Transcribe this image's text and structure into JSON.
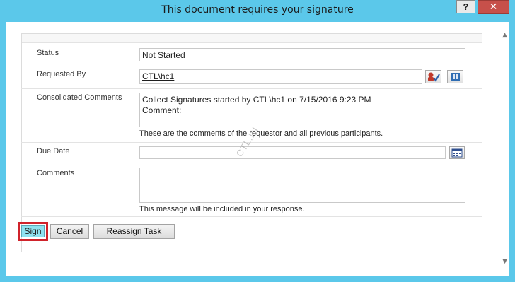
{
  "window": {
    "title": "This document requires your signature",
    "help_label": "?",
    "close_label": "✕"
  },
  "form": {
    "status": {
      "label": "Status",
      "value": "Not Started"
    },
    "requested_by": {
      "label": "Requested By",
      "value": "CTL\\hc1"
    },
    "consolidated_comments": {
      "label": "Consolidated Comments",
      "line1": "Collect Signatures started by CTL\\hc1 on 7/15/2016 9:23 PM",
      "line2": "Comment:",
      "hint": "These are the comments of the requestor and all previous participants."
    },
    "due_date": {
      "label": "Due Date",
      "value": ""
    },
    "comments": {
      "label": "Comments",
      "value": "",
      "hint": "This message will be included in your response."
    }
  },
  "buttons": {
    "sign": "Sign",
    "cancel": "Cancel",
    "reassign": "Reassign Task"
  },
  "watermark": "CTL.IN",
  "icons": {
    "check_names": "check-names-icon",
    "browse": "address-book-icon",
    "calendar": "calendar-icon"
  },
  "colors": {
    "titlebar": "#5bc8ea",
    "close": "#c7504a",
    "sign_highlight": "#d0232b",
    "sign_fill": "#8fe2f0"
  }
}
